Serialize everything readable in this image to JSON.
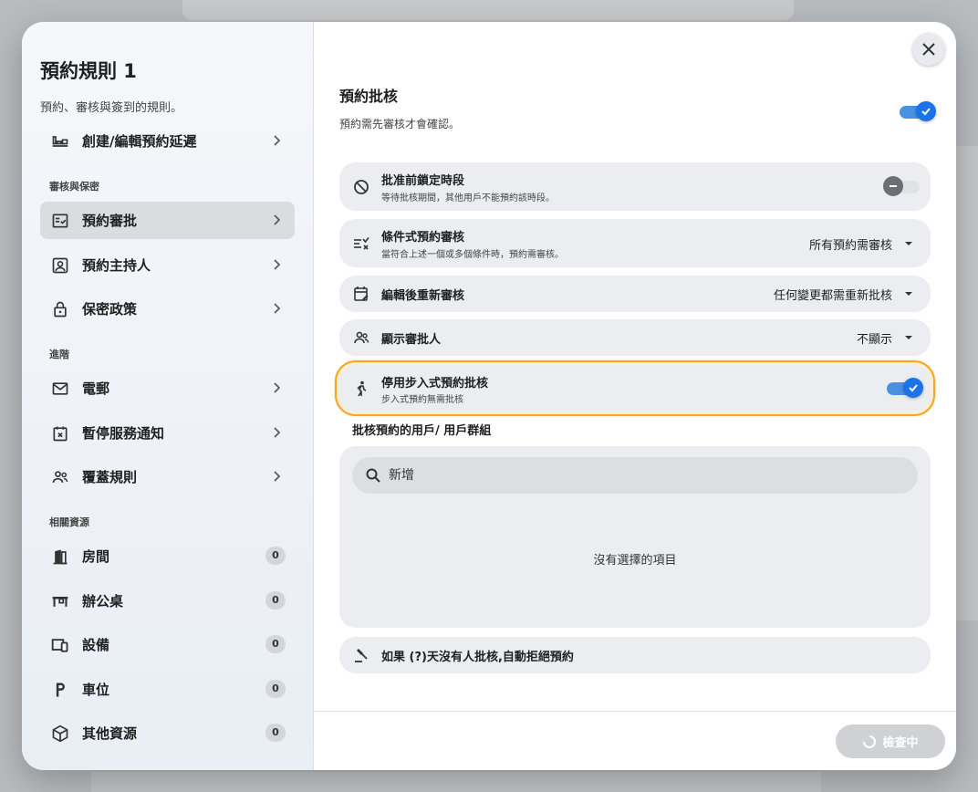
{
  "sidebar": {
    "title": "預約規則 1",
    "subtitle": "預約、審核與簽到的規則。",
    "top_item": {
      "label": "創建/編輯預約延遲",
      "icon": "booking-delay-icon"
    },
    "sections": [
      {
        "heading": "審核與保密",
        "items": [
          {
            "label": "預約審批",
            "icon": "approval-icon",
            "active": true
          },
          {
            "label": "預約主持人",
            "icon": "host-icon"
          },
          {
            "label": "保密政策",
            "icon": "lock-icon"
          }
        ]
      },
      {
        "heading": "進階",
        "items": [
          {
            "label": "電郵",
            "icon": "mail-icon"
          },
          {
            "label": "暫停服務通知",
            "icon": "calendar-x-icon"
          },
          {
            "label": "覆蓋規則",
            "icon": "people-icon"
          }
        ]
      },
      {
        "heading": "相關資源",
        "items": [
          {
            "label": "房間",
            "icon": "door-icon",
            "count": "0"
          },
          {
            "label": "辦公桌",
            "icon": "desk-icon",
            "count": "0"
          },
          {
            "label": "設備",
            "icon": "devices-icon",
            "count": "0"
          },
          {
            "label": "車位",
            "icon": "parking-icon",
            "count": "0"
          },
          {
            "label": "其他資源",
            "icon": "box-icon",
            "count": "0"
          }
        ]
      }
    ]
  },
  "main": {
    "title": "預約批核",
    "subtitle": "預約需先審核才會確認。",
    "main_toggle_on": true,
    "rows": [
      {
        "title": "批准前鎖定時段",
        "desc": "等待批核期間，其他用戶不能預約該時段。",
        "icon": "block-icon",
        "toggle": false
      },
      {
        "title": "條件式預約審核",
        "desc": "當符合上述一個或多個條件時，預約需審核。",
        "icon": "conditional-icon",
        "value": "所有預約需審核"
      },
      {
        "title": "編輯後重新審核",
        "icon": "calendar-edit-icon",
        "value": "任何變更都需重新批核"
      },
      {
        "title": "顯示審批人",
        "icon": "people-icon",
        "value": "不顯示"
      },
      {
        "title": "停用步入式預約批核",
        "desc": "步入式預約無需批核",
        "icon": "walk-icon",
        "toggle": true
      }
    ],
    "users_label": "批核預約的用戶/ 用戶群組",
    "search_placeholder": "新增",
    "empty_text": "沒有選擇的項目",
    "auto_reject": {
      "title": "如果 (?)天沒有人批核,自動拒絕預約",
      "icon": "gavel-icon"
    },
    "check_button": "檢查中",
    "accent_color": "#1a73e8",
    "highlight_color": "#f5a623"
  }
}
